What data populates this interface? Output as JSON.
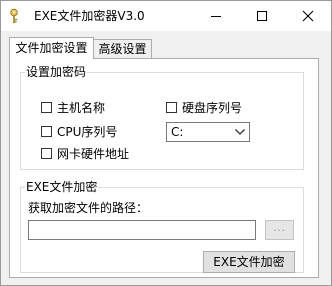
{
  "window": {
    "title": "EXE文件加密器V3.0",
    "icons": {
      "app": "key-icon",
      "minimize": "minimize-icon",
      "maximize": "maximize-icon",
      "close": "close-icon"
    }
  },
  "tabs": [
    {
      "label": "文件加密设置",
      "active": true
    },
    {
      "label": "高级设置",
      "active": false
    }
  ],
  "password_group": {
    "legend": "设置加密码",
    "options": {
      "hostname": {
        "label": "主机名称",
        "checked": false
      },
      "cpu_serial": {
        "label": "CPU序列号",
        "checked": false
      },
      "mac_address": {
        "label": "网卡硬件地址",
        "checked": false
      },
      "disk_serial": {
        "label": "硬盘序列号",
        "checked": false
      }
    },
    "drive_select": {
      "value": "C:"
    }
  },
  "exe_group": {
    "legend": "EXE文件加密",
    "path_label": "获取加密文件的路径：",
    "path_value": "",
    "browse_label": "...",
    "encrypt_label": "EXE文件加密"
  }
}
